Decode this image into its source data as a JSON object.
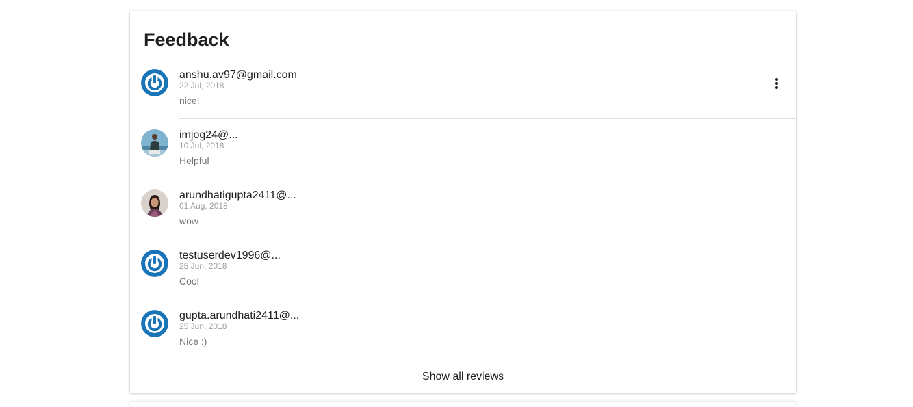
{
  "feedback": {
    "title": "Feedback",
    "reviews": [
      {
        "name": "anshu.av97@gmail.com",
        "date": "22 Jul, 2018",
        "comment": "nice!",
        "avatar": "power-logo-avatar"
      },
      {
        "name": "imjog24@...",
        "date": "10 Jul, 2018",
        "comment": "Helpful",
        "avatar": "user-photo-avatar"
      },
      {
        "name": "arundhatigupta2411@...",
        "date": "01 Aug, 2018",
        "comment": "wow",
        "avatar": "user-photo-avatar"
      },
      {
        "name": "testuserdev1996@...",
        "date": "25 Jun, 2018",
        "comment": "Cool",
        "avatar": "power-logo-avatar"
      },
      {
        "name": "gupta.arundhati2411@...",
        "date": "25 Jun, 2018",
        "comment": "Nice :)",
        "avatar": "power-logo-avatar"
      }
    ],
    "more_icon": "more-vert-icon",
    "show_all_label": "Show all reviews",
    "colors": {
      "logo_blue": "#1a75b8",
      "title_text": "#212121",
      "date_text": "#9e9e9e",
      "comment_text": "#757575",
      "divider": "#e0e0e0"
    }
  }
}
